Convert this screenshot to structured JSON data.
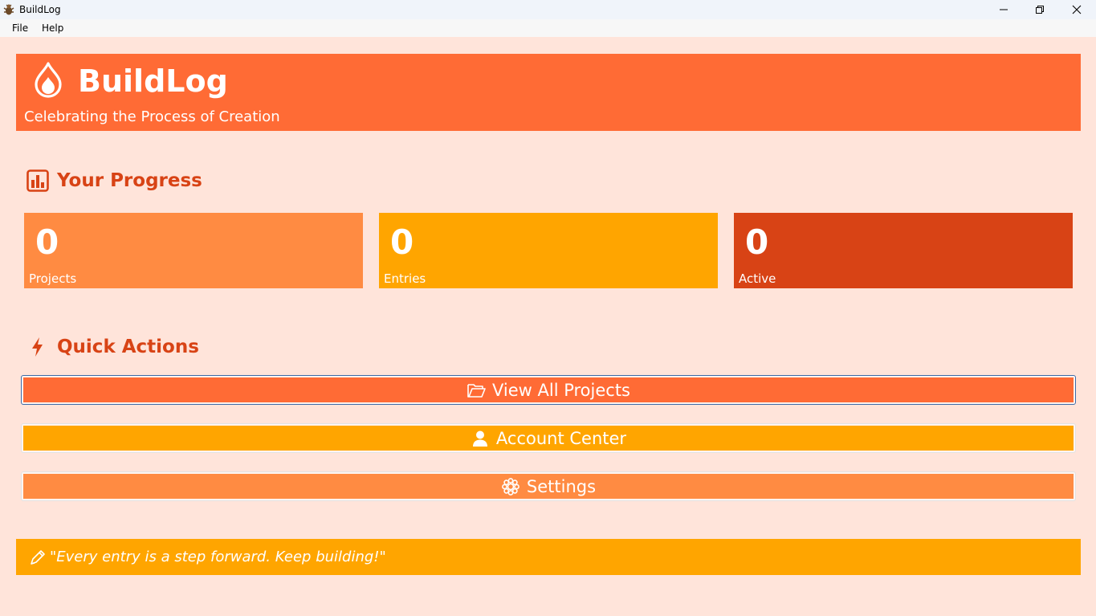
{
  "window": {
    "title": "BuildLog",
    "app_icon": "bug-icon",
    "controls": [
      "minimize-icon",
      "restore-icon",
      "close-icon"
    ]
  },
  "menu": {
    "items": [
      {
        "label": "File"
      },
      {
        "label": "Help"
      }
    ]
  },
  "header": {
    "icon": "flame-icon",
    "title": "BuildLog",
    "subtitle": "Celebrating the Process of Creation",
    "color": "#FF6B35"
  },
  "progress": {
    "icon": "bar-chart-icon",
    "title": "Your Progress",
    "stats": [
      {
        "value": "0",
        "label": "Projects",
        "color": "#FF8B42"
      },
      {
        "value": "0",
        "label": "Entries",
        "color": "#FFA500"
      },
      {
        "value": "0",
        "label": "Active",
        "color": "#D84315"
      }
    ]
  },
  "quick_actions": {
    "icon": "lightning-icon",
    "title": "Quick Actions",
    "buttons": [
      {
        "label": "View All Projects",
        "icon": "folder-open-icon",
        "color": "#FF6B35"
      },
      {
        "label": "Account Center",
        "icon": "user-icon",
        "color": "#FFA500"
      },
      {
        "label": "Settings",
        "icon": "gear-icon",
        "color": "#FF8B42"
      }
    ]
  },
  "quote": {
    "icon": "pen-icon",
    "text": "\"Every entry is a step forward. Keep building!\"",
    "color": "#FFA500"
  },
  "colors": {
    "background": "#FFE4DA",
    "accent_text": "#D84315"
  }
}
